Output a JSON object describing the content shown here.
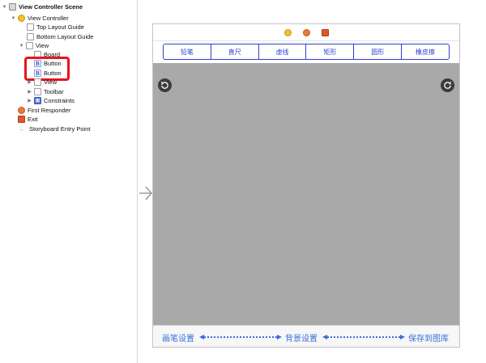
{
  "outline": {
    "scene_title": "View Controller Scene",
    "view_controller": "View Controller",
    "top_layout_guide": "Top Layout Guide",
    "bottom_layout_guide": "Bottom Layout Guide",
    "view": "View",
    "board": "Board",
    "button_1": "Button",
    "button_2": "Button",
    "subview": "View",
    "toolbar": "Toolbar",
    "constraints": "Constraints",
    "first_responder": "First Responder",
    "exit": "Exit",
    "storyboard_entry": "Storyboard Entry Point",
    "highlight_color": "#e8141b"
  },
  "canvas": {
    "segments": [
      "铅笔",
      "直尺",
      "虚线",
      "矩形",
      "圆形",
      "橡皮擦"
    ],
    "board_color": "#a9a9a9",
    "accent_color": "#2f3fd0",
    "toolbar": {
      "left_item": "画笔设置",
      "middle_item": "背景设置",
      "right_item": "保存到图库",
      "item_color": "#3a6fd8"
    }
  }
}
